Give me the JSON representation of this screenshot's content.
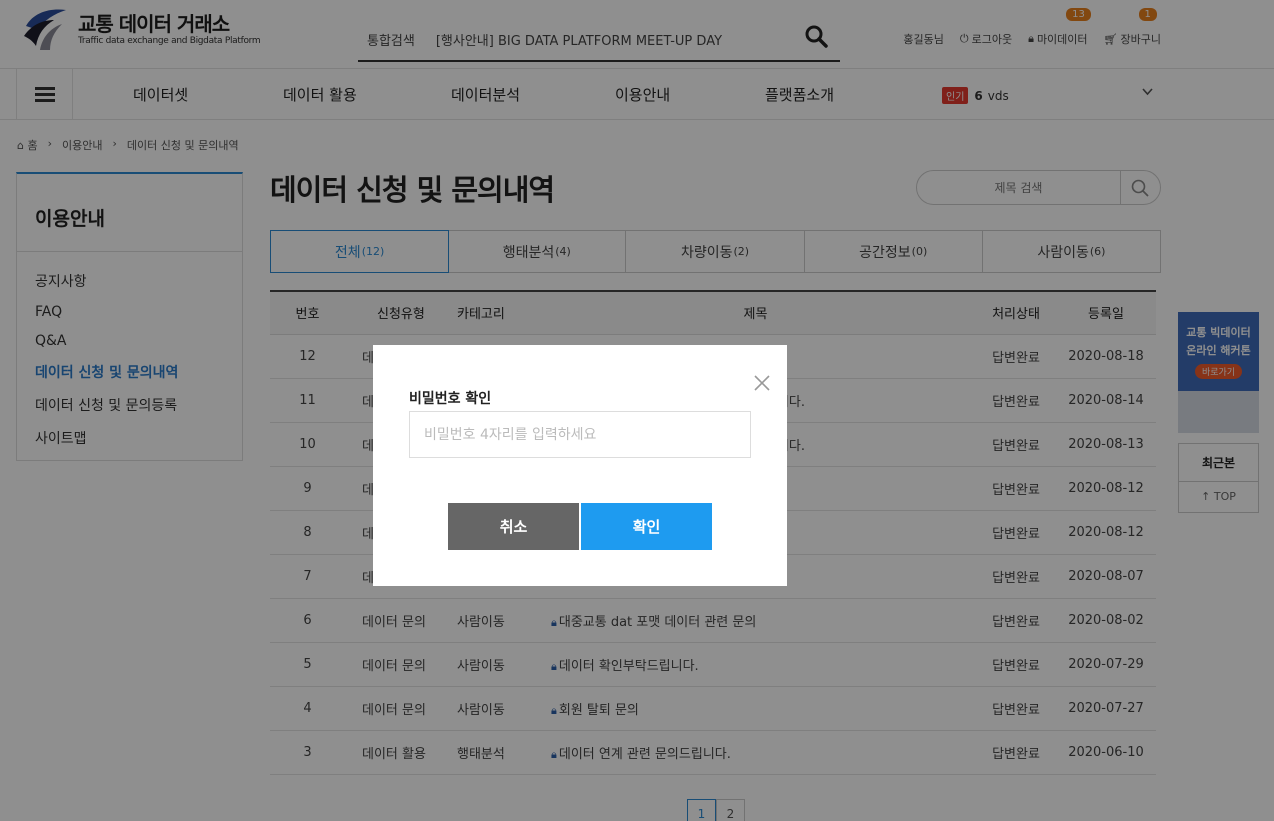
{
  "header": {
    "logo_title": "교통 데이터 거래소",
    "logo_sub": "Traffic data exchange and Bigdata Platform",
    "search_category": "통합검색",
    "search_value": "[행사안내] BIG DATA PLATFORM MEET-UP DAY",
    "user_name": "홍길동님",
    "logout": "로그아웃",
    "mydata": "마이데이터",
    "mydata_count": "13",
    "cart": "장바구니",
    "cart_count": "1"
  },
  "gnb": {
    "items": [
      "데이터셋",
      "데이터 활용",
      "데이터분석",
      "이용안내",
      "플랫폼소개"
    ],
    "popular_tag": "인기",
    "popular_rank": "6",
    "popular_word": "vds"
  },
  "breadcrumb": [
    "홈",
    "이용안내",
    "데이터 신청 및 문의내역"
  ],
  "sidebar": {
    "title": "이용안내",
    "items": [
      "공지사항",
      "FAQ",
      "Q&A",
      "데이터 신청 및 문의내역",
      "데이터 신청 및 문의등록",
      "사이트맵"
    ]
  },
  "page": {
    "title": "데이터 신청 및 문의내역",
    "search_placeholder": "제목 검색"
  },
  "tabs": [
    {
      "label": "전체",
      "count": "(12)"
    },
    {
      "label": "행태분석",
      "count": "(4)"
    },
    {
      "label": "차량이동",
      "count": "(2)"
    },
    {
      "label": "공간정보",
      "count": "(0)"
    },
    {
      "label": "사람이동",
      "count": "(6)"
    }
  ],
  "table": {
    "headers": [
      "번호",
      "신청유형",
      "카테고리",
      "제목",
      "처리상태",
      "등록일"
    ],
    "rows": [
      {
        "no": "12",
        "type": "데",
        "cat": "",
        "title": "",
        "status": "답변완료",
        "date": "2020-08-18"
      },
      {
        "no": "11",
        "type": "데",
        "cat": "",
        "title": "립니다.",
        "status": "답변완료",
        "date": "2020-08-14"
      },
      {
        "no": "10",
        "type": "데",
        "cat": "",
        "title": "립니다.",
        "status": "답변완료",
        "date": "2020-08-13"
      },
      {
        "no": "9",
        "type": "데",
        "cat": "",
        "title": "",
        "status": "답변완료",
        "date": "2020-08-12"
      },
      {
        "no": "8",
        "type": "데",
        "cat": "",
        "title": "",
        "status": "답변완료",
        "date": "2020-08-12"
      },
      {
        "no": "7",
        "type": "데",
        "cat": "",
        "title": "",
        "status": "답변완료",
        "date": "2020-08-07"
      },
      {
        "no": "6",
        "type": "데이터 문의",
        "cat": "사람이동",
        "title": "대중교통 dat 포맷 데이터 관련 문의",
        "status": "답변완료",
        "date": "2020-08-02"
      },
      {
        "no": "5",
        "type": "데이터 문의",
        "cat": "사람이동",
        "title": "데이터 확인부탁드립니다.",
        "status": "답변완료",
        "date": "2020-07-29"
      },
      {
        "no": "4",
        "type": "데이터 문의",
        "cat": "사람이동",
        "title": "회원 탈퇴 문의",
        "status": "답변완료",
        "date": "2020-07-27"
      },
      {
        "no": "3",
        "type": "데이터 활용",
        "cat": "행태분석",
        "title": "데이터 연계 관련 문의드립니다.",
        "status": "답변완료",
        "date": "2020-06-10"
      }
    ]
  },
  "paging": [
    "1",
    "2"
  ],
  "quick": {
    "banner_line1": "교통 빅데이터",
    "banner_line2": "온라인 해커톤",
    "banner_btn": "바로가기",
    "recent": "최근본",
    "top": "TOP"
  },
  "modal": {
    "label": "비밀번호 확인",
    "placeholder": "비밀번호 4자리를 입력하세요",
    "cancel": "취소",
    "confirm": "확인"
  },
  "colors": {
    "accent": "#2c8ad3",
    "confirm": "#1e9bf0",
    "cancel": "#666666",
    "badge": "#e8801e"
  }
}
